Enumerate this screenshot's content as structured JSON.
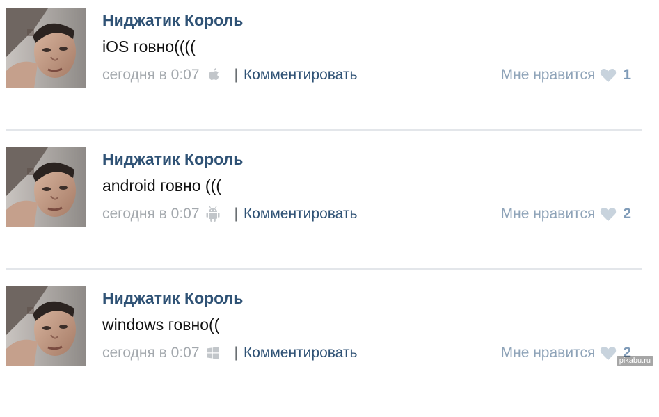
{
  "posts": [
    {
      "author": "Ниджатик Король",
      "text": "iOS говно((((",
      "time": "сегодня в 0:07",
      "platform_icon": "apple-icon",
      "comment_label": "Комментировать",
      "like_label": "Мне нравится",
      "like_count": "1"
    },
    {
      "author": "Ниджатик Король",
      "text": "android говно (((",
      "time": "сегодня в 0:07",
      "platform_icon": "android-icon",
      "comment_label": "Комментировать",
      "like_label": "Мне нравится",
      "like_count": "2"
    },
    {
      "author": "Ниджатик Король",
      "text": "windows говно((",
      "time": "сегодня в 0:07",
      "platform_icon": "windows-icon",
      "comment_label": "Комментировать",
      "like_label": "Мне нравится",
      "like_count": "2"
    }
  ],
  "separator": "|",
  "watermark": "pikabu.ru",
  "colors": {
    "author": "#2f5275",
    "meta_gray": "#a3a8ad",
    "like_blue": "#8ea3b8",
    "heart_fill": "#c8d3dd",
    "divider": "#e3e6ea"
  }
}
